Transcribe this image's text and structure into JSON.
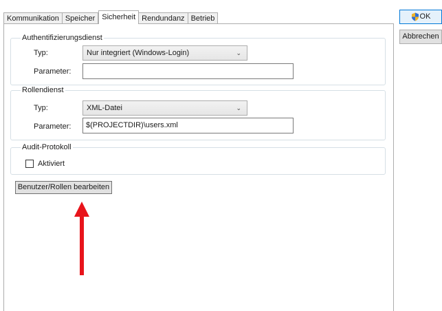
{
  "tabs": [
    {
      "label": "Kommunikation"
    },
    {
      "label": "Speicher"
    },
    {
      "label": "Sicherheit"
    },
    {
      "label": "Rendundanz"
    },
    {
      "label": "Betrieb"
    }
  ],
  "auth_group": {
    "title": "Authentifizierungsdienst",
    "type_label": "Typ:",
    "type_value": "Nur integriert (Windows-Login)",
    "param_label": "Parameter:",
    "param_value": ""
  },
  "role_group": {
    "title": "Rollendienst",
    "type_label": "Typ:",
    "type_value": "XML-Datei",
    "param_label": "Parameter:",
    "param_value": "$(PROJECTDIR)\\users.xml"
  },
  "audit_group": {
    "title": "Audit-Protokoll",
    "checkbox_label": "Aktiviert",
    "checked": false
  },
  "edit_button_label": "Benutzer/Rollen bearbeiten",
  "ok_label": "OK",
  "cancel_label": "Abbrechen",
  "colors": {
    "annotation_arrow": "#e8141b",
    "ok_border": "#0078d7"
  },
  "icons": {
    "combo_arrow": "chevron-down-icon",
    "ok_shield": "shield-icon"
  }
}
